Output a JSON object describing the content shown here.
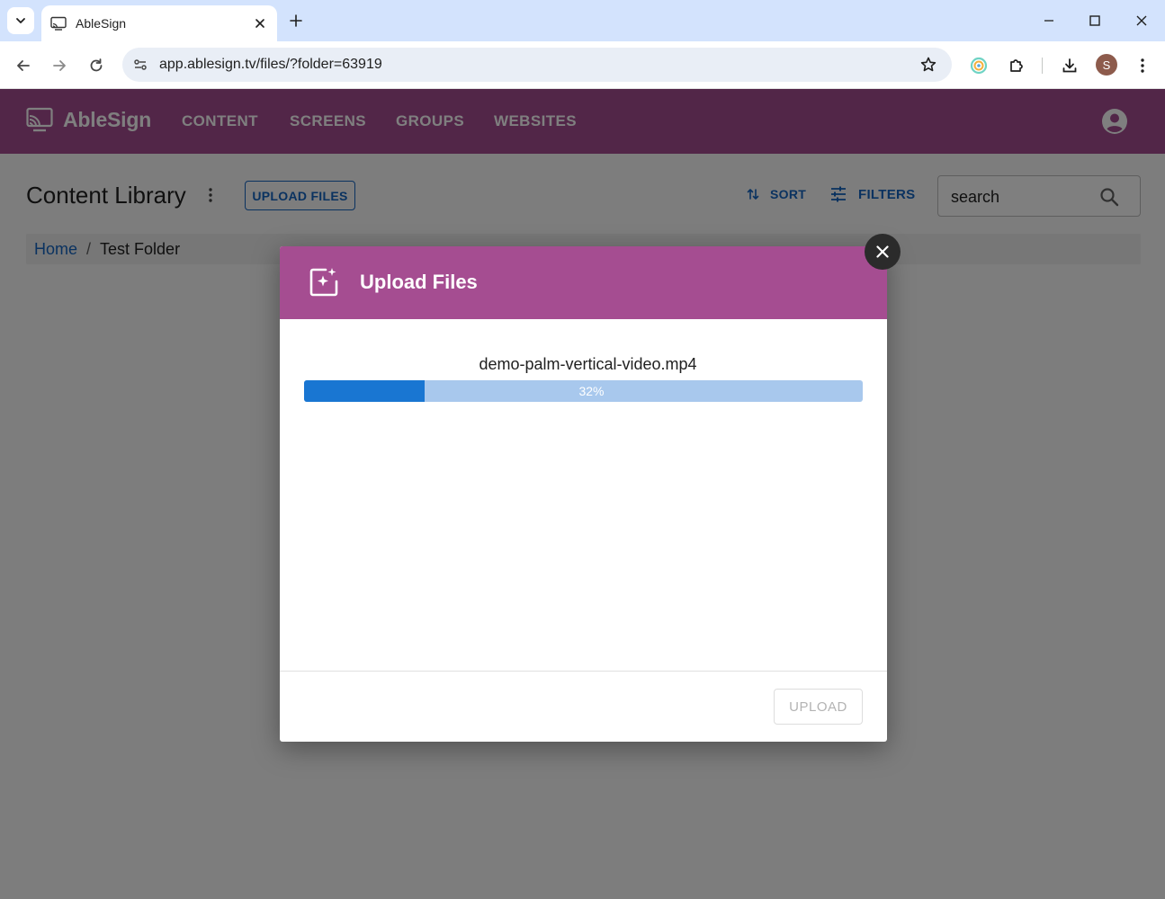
{
  "browser": {
    "tab_title": "AbleSign",
    "url": "app.ablesign.tv/files/?folder=63919",
    "profile_initial": "S"
  },
  "app": {
    "brand": "AbleSign",
    "nav": [
      "CONTENT",
      "SCREENS",
      "GROUPS",
      "WEBSITES"
    ]
  },
  "library": {
    "title": "Content Library",
    "upload_label": "UPLOAD FILES",
    "sort_label": "SORT",
    "filters_label": "FILTERS",
    "search_placeholder": "search",
    "breadcrumb": {
      "home": "Home",
      "separator": "/",
      "current": "Test Folder"
    }
  },
  "modal": {
    "title": "Upload Files",
    "file_name": "demo-palm-vertical-video.mp4",
    "progress_percent": 21.5,
    "progress_label": "32%",
    "upload_label": "UPLOAD"
  },
  "colors": {
    "brand": "#a54d91",
    "primary": "#1565c0",
    "progress_fill": "#1976d2",
    "progress_track": "#a8c8ed"
  }
}
